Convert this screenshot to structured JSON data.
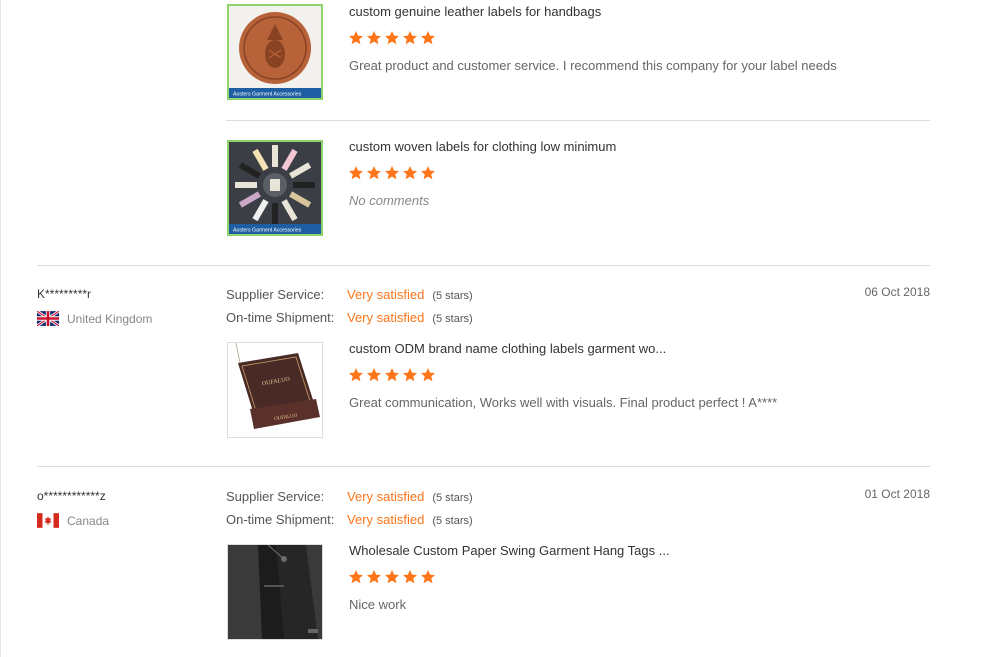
{
  "reviews_top": [
    {
      "product": "custom genuine leather labels for handbags",
      "comment": "Great product and customer service. I recommend this company for your label needs",
      "thumb_caption": "Aosters Garment Accessories",
      "rating": 5
    },
    {
      "product": "custom woven labels for clothing low minimum",
      "comment": "No comments",
      "thumb_caption": "Aosters Garment Accessories",
      "rating": 5
    }
  ],
  "labels": {
    "supplier_service": "Supplier Service:",
    "ontime_shipment": "On-time Shipment:"
  },
  "reviews": [
    {
      "reviewer": "K*********r",
      "country": "United Kingdom",
      "date": "06 Oct 2018",
      "supplier_service": "Very satisfied",
      "supplier_stars": "(5 stars)",
      "ontime_shipment": "Very satisfied",
      "ontime_stars": "(5 stars)",
      "product": "custom ODM brand name clothing labels garment wo...",
      "comment": "Great communication, Works well with visuals. Final product perfect ! A****",
      "rating": 5
    },
    {
      "reviewer": "o************z",
      "country": "Canada",
      "date": "01 Oct 2018",
      "supplier_service": "Very satisfied",
      "supplier_stars": "(5 stars)",
      "ontime_shipment": "Very satisfied",
      "ontime_stars": "(5 stars)",
      "product": "Wholesale Custom Paper Swing Garment Hang Tags ...",
      "comment": "Nice work",
      "rating": 5
    }
  ],
  "colors": {
    "accent": "#ff7519",
    "star": "#ff7519",
    "thumb_border": "#8cd36a"
  },
  "icons": [
    "star-icon",
    "uk-flag-icon",
    "canada-flag-icon"
  ]
}
